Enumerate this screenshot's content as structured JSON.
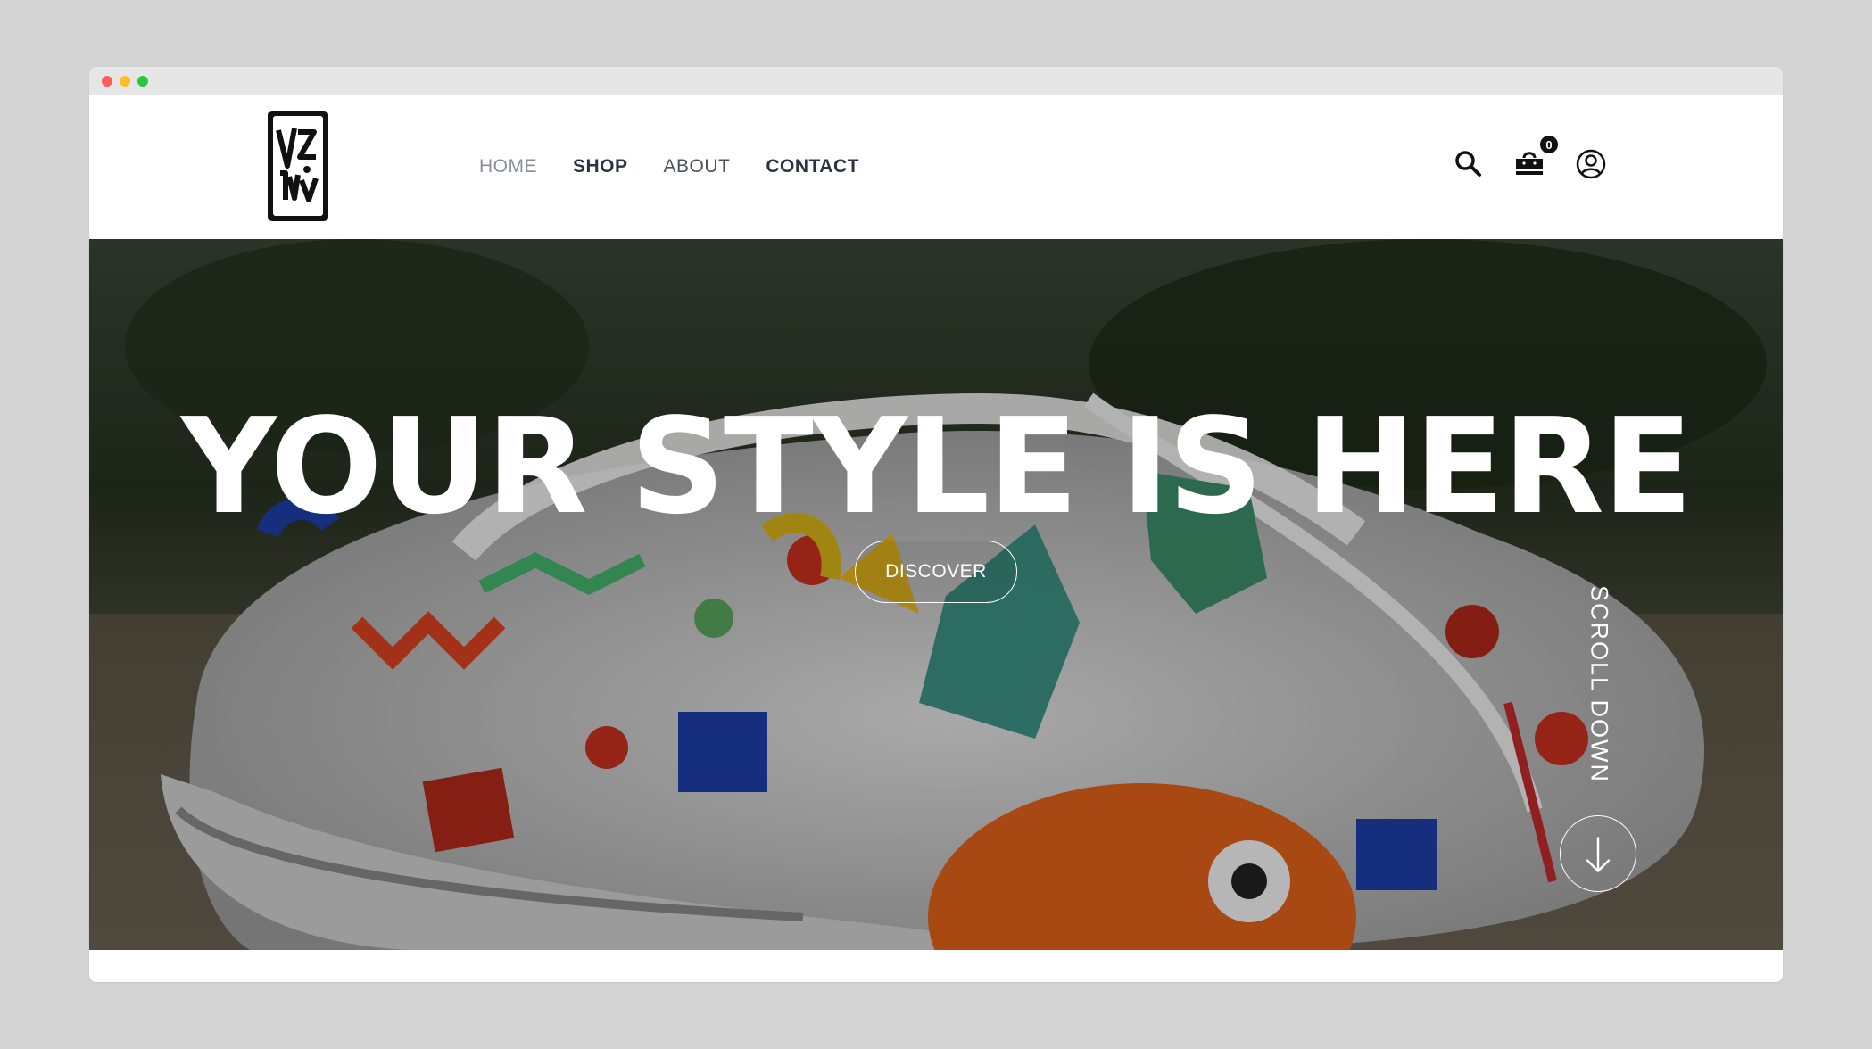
{
  "window": {
    "controls": [
      "close",
      "minimize",
      "maximize"
    ]
  },
  "header": {
    "logo": {
      "alt": "logo",
      "icon": "brand-logo"
    },
    "nav": [
      {
        "label": "HOME",
        "active": true
      },
      {
        "label": "SHOP",
        "active": false
      },
      {
        "label": "ABOUT",
        "active": false
      },
      {
        "label": "CONTACT",
        "active": false
      }
    ],
    "icons": {
      "search": "search-icon",
      "cart": "shopping-bag-icon",
      "account": "user-circle-icon"
    },
    "cart_count": "0"
  },
  "hero": {
    "title": "YOUR STYLE IS HERE",
    "cta_label": "DISCOVER",
    "scroll_label": "SCROLL DOWN",
    "scroll_icon": "arrow-down-icon"
  }
}
